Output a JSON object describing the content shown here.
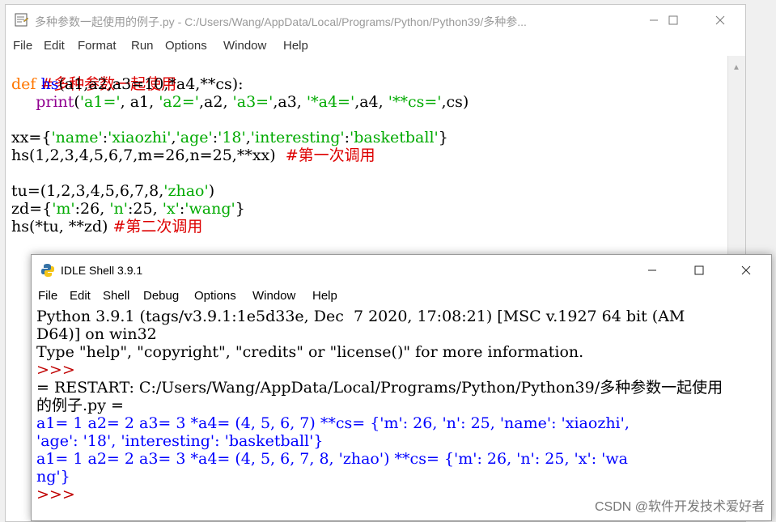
{
  "editor": {
    "title": "多种参数一起使用的例子.py - C:/Users/Wang/AppData/Local/Programs/Python/Python39/多种参...",
    "menu": [
      "File",
      "Edit",
      "Format",
      "Run",
      "Options",
      "Window",
      "Help"
    ],
    "code": {
      "l1": "#多种参数一起使用",
      "l2_def": "def",
      "l2_name": " hs",
      "l2_rest": "(a1,a2,a3=10,*a4,**cs):",
      "l3_indent": "     ",
      "l3_print": "print",
      "l3_p1": "(",
      "l3_s1": "'a1='",
      "l3_p2": ", a1, ",
      "l3_s2": "'a2='",
      "l3_p3": ",a2, ",
      "l3_s3": "'a3='",
      "l3_p4": ",a3, ",
      "l3_s4": "'*a4='",
      "l3_p5": ",a4, ",
      "l3_s5": "'**cs='",
      "l3_p6": ",cs)",
      "l5_a": "xx={",
      "l5_s1": "'name'",
      "l5_b": ":",
      "l5_s2": "'xiaozhi'",
      "l5_c": ",",
      "l5_s3": "'age'",
      "l5_d": ":",
      "l5_s4": "'18'",
      "l5_e": ",",
      "l5_s5": "'interesting'",
      "l5_f": ":",
      "l5_s6": "'basketball'",
      "l5_g": "}",
      "l6_code": "hs(1,2,3,4,5,6,7,m=26,n=25,**xx)  ",
      "l6_comment": "#第一次调用",
      "l8_a": "tu=(1,2,3,4,5,6,7,8,",
      "l8_s": "'zhao'",
      "l8_b": ")",
      "l9_a": "zd={",
      "l9_s1": "'m'",
      "l9_b": ":26, ",
      "l9_s2": "'n'",
      "l9_c": ":25, ",
      "l9_s3": "'x'",
      "l9_d": ":",
      "l9_s4": "'wang'",
      "l9_e": "}",
      "l10_code": "hs(*tu, **zd) ",
      "l10_comment": "#第二次调用"
    }
  },
  "shell": {
    "title": "IDLE Shell 3.9.1",
    "menu": [
      "File",
      "Edit",
      "Shell",
      "Debug",
      "Options",
      "Window",
      "Help"
    ],
    "output": {
      "l1": "Python 3.9.1 (tags/v3.9.1:1e5d33e, Dec  7 2020, 17:08:21) [MSC v.1927 64 bit (AM",
      "l2": "D64)] on win32",
      "l3": "Type \"help\", \"copyright\", \"credits\" or \"license()\" for more information.",
      "l4": ">>>",
      "l5": "= RESTART: C:/Users/Wang/AppData/Local/Programs/Python/Python39/多种参数一起使用",
      "l6": "的例子.py =",
      "l7": "a1= 1 a2= 2 a3= 3 *a4= (4, 5, 6, 7) **cs= {'m': 26, 'n': 25, 'name': 'xiaozhi',",
      "l8": "'age': '18', 'interesting': 'basketball'}",
      "l9": "a1= 1 a2= 2 a3= 3 *a4= (4, 5, 6, 7, 8, 'zhao') **cs= {'m': 26, 'n': 25, 'x': 'wa",
      "l10": "ng'}",
      "l11": ">>>"
    }
  },
  "watermark": "CSDN @软件开发技术爱好者",
  "colors": {
    "keyword": "#ff7700",
    "builtin": "#900090",
    "string": "#00aa00",
    "comment": "#dd0000",
    "stdout": "#0000ff",
    "prompt": "#c00000"
  },
  "icons": [
    "python-idle-icon",
    "minimize-icon",
    "maximize-icon",
    "close-icon",
    "scroll-up-arrow-icon"
  ]
}
